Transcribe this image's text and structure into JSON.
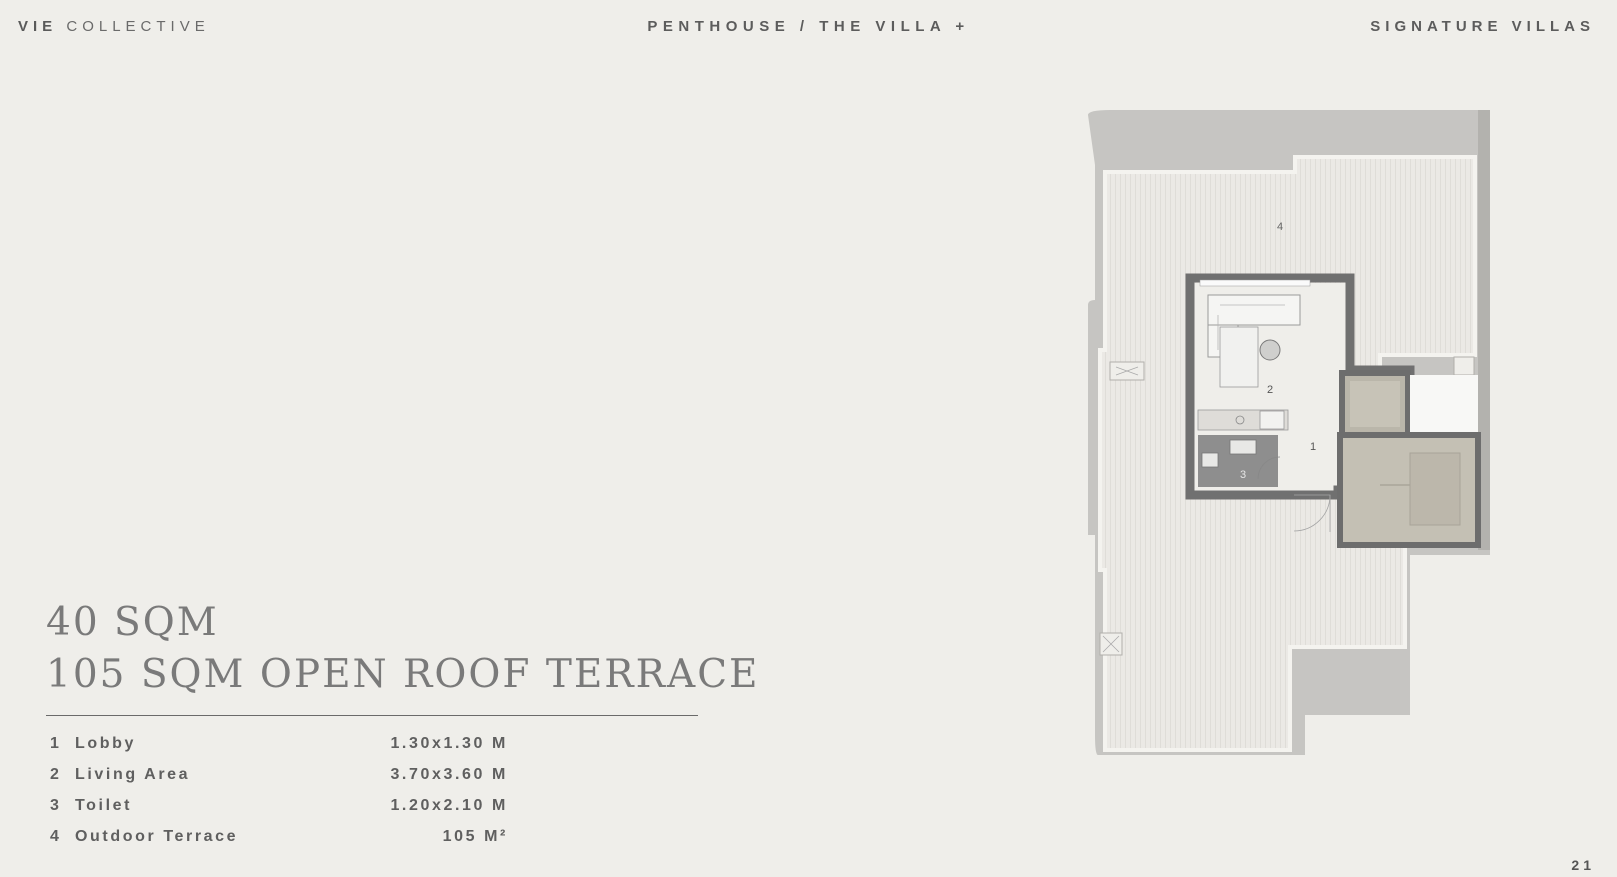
{
  "header": {
    "brand_bold": "VIE",
    "brand_light": "COLLECTIVE",
    "center": "PENTHOUSE / THE VILLA +",
    "right": "SIGNATURE VILLAS"
  },
  "headline": {
    "line1": "40 SQM",
    "line2": "105 SQM OPEN ROOF TERRACE"
  },
  "rooms": [
    {
      "num": "1",
      "name": "Lobby",
      "dim": "1.30x1.30 M"
    },
    {
      "num": "2",
      "name": "Living Area",
      "dim": "3.70x3.60 M"
    },
    {
      "num": "3",
      "name": "Toilet",
      "dim": "1.20x2.10 M"
    },
    {
      "num": "4",
      "name": "Outdoor Terrace",
      "dim": "105 M²"
    }
  ],
  "plan_labels": {
    "terrace": "4",
    "living": "2",
    "lobby": "1",
    "toilet": "3"
  },
  "page_number": "21"
}
